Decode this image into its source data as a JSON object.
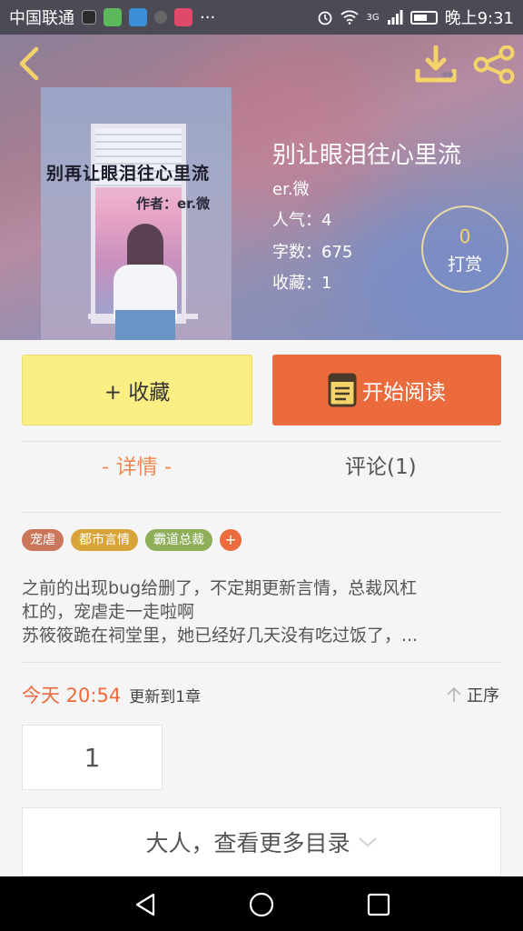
{
  "status_bar": {
    "carrier": "中国联通",
    "dots": "···",
    "network": "3G",
    "time": "晚上9:31"
  },
  "book": {
    "title": "别让眼泪往心里流",
    "author": "er.微",
    "cover_title": "别再让眼泪往心里流",
    "cover_author": "作者：er.微",
    "popularity": "人气：4",
    "word_count": "字数：675",
    "favorites": "收藏：1"
  },
  "tip": {
    "count": "0",
    "label": "打赏"
  },
  "actions": {
    "favorite_label": "+ 收藏",
    "read_label": "开始阅读"
  },
  "tabs": {
    "detail": "- 详情 -",
    "comments": "评论(1)"
  },
  "tags": [
    {
      "label": "宠虐",
      "color": "#c9765a"
    },
    {
      "label": "都市言情",
      "color": "#d8a43a"
    },
    {
      "label": "霸道总裁",
      "color": "#8fae5a"
    }
  ],
  "tag_add": "+",
  "description": [
    "之前的出现bug给删了，不定期更新言情，总裁风杠",
    "杠的，宠虐走一走啦啊",
    "苏筱筱跪在祠堂里，她已经好几天没有吃过饭了，..."
  ],
  "update": {
    "time": "今天 20:54",
    "info": "更新到1章"
  },
  "sort_label": "正序",
  "chapters": [
    {
      "label": "1"
    }
  ],
  "more_label": "大人，查看更多目录",
  "colors": {
    "accent": "#ec6b3d",
    "favorite_button": "#fbee84",
    "tip_number": "#f3d36a"
  },
  "icons": {
    "back": "back-arrow-icon",
    "download": "download-icon",
    "share": "share-icon",
    "book": "book-icon",
    "sort": "arrow-up-icon",
    "more": "chevron-down-icon",
    "nav": [
      "nav-back-icon",
      "nav-home-icon",
      "nav-recents-icon"
    ]
  }
}
